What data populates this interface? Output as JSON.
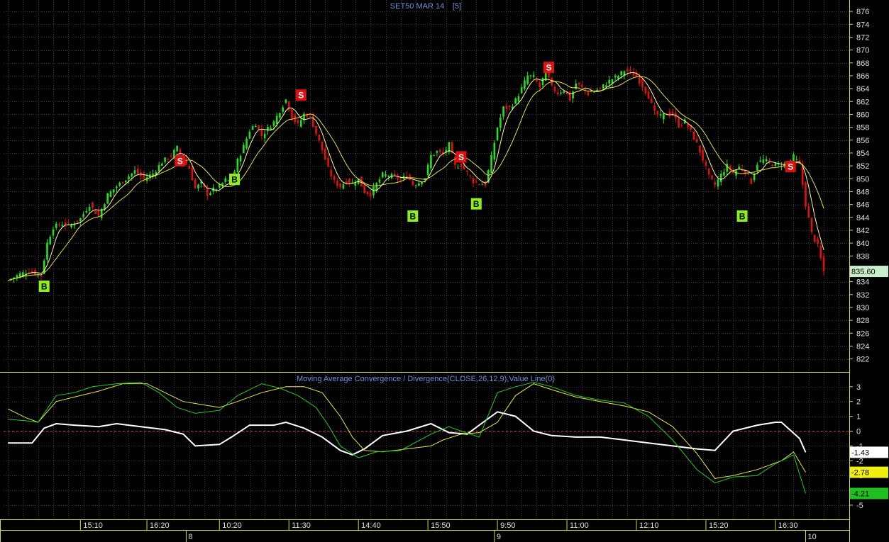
{
  "chart_data": [
    {
      "type": "candlestick",
      "title": "SET50 MAR 14",
      "period": "[5]",
      "ylim": [
        820,
        877
      ],
      "y_ticks": [
        876,
        874,
        872,
        870,
        868,
        866,
        864,
        862,
        860,
        858,
        856,
        854,
        852,
        850,
        848,
        846,
        844,
        842,
        840,
        838,
        836,
        834,
        832,
        830,
        828,
        826,
        824,
        822
      ],
      "last_price": "835.60",
      "colors": {
        "up": "#20e020",
        "down": "#e01010",
        "ma_fast": "#fff8a0",
        "ma_slow": "#e0e040",
        "grid": "#3a3a3a",
        "axis": "#d8d840",
        "title": "#6f8fd8"
      },
      "close_path": [
        [
          0,
          834.2
        ],
        [
          4,
          835.2
        ],
        [
          7,
          835.6
        ],
        [
          11,
          835.0
        ],
        [
          13,
          840.0
        ],
        [
          15,
          842.5
        ],
        [
          18,
          843.0
        ],
        [
          21,
          842.8
        ],
        [
          24,
          843.8
        ],
        [
          27,
          846.0
        ],
        [
          30,
          844.2
        ],
        [
          33,
          847.5
        ],
        [
          36,
          848.8
        ],
        [
          39,
          850.0
        ],
        [
          42,
          851.2
        ],
        [
          45,
          850.0
        ],
        [
          48,
          850.8
        ],
        [
          51,
          852.6
        ],
        [
          54,
          853.6
        ],
        [
          56,
          854.8
        ],
        [
          58,
          852.8
        ],
        [
          60,
          851.6
        ],
        [
          62,
          848.5
        ],
        [
          64,
          849.3
        ],
        [
          66,
          847.6
        ],
        [
          68,
          848.3
        ],
        [
          70,
          848.8
        ],
        [
          72,
          849.8
        ],
        [
          74,
          849.5
        ],
        [
          76,
          852.8
        ],
        [
          78,
          855.0
        ],
        [
          80,
          857.5
        ],
        [
          82,
          858.6
        ],
        [
          84,
          856.7
        ],
        [
          86,
          857.8
        ],
        [
          88,
          858.8
        ],
        [
          90,
          860.6
        ],
        [
          92,
          862.3
        ],
        [
          94,
          859.6
        ],
        [
          96,
          858.3
        ],
        [
          98,
          860.0
        ],
        [
          100,
          859.8
        ],
        [
          102,
          857.0
        ],
        [
          104,
          854.5
        ],
        [
          106,
          851.5
        ],
        [
          108,
          849.5
        ],
        [
          110,
          848.8
        ],
        [
          112,
          849.6
        ],
        [
          114,
          849.3
        ],
        [
          116,
          849.9
        ],
        [
          118,
          848.0
        ],
        [
          120,
          847.6
        ],
        [
          122,
          849.2
        ],
        [
          124,
          850.6
        ],
        [
          126,
          850.5
        ],
        [
          128,
          850.3
        ],
        [
          130,
          849.8
        ],
        [
          132,
          850.6
        ],
        [
          134,
          849.1
        ],
        [
          136,
          849.4
        ],
        [
          138,
          850.2
        ],
        [
          140,
          853.6
        ],
        [
          142,
          854.2
        ],
        [
          144,
          853.8
        ],
        [
          146,
          855.3
        ],
        [
          148,
          851.9
        ],
        [
          150,
          852.1
        ],
        [
          152,
          850.9
        ],
        [
          154,
          849.6
        ],
        [
          156,
          849.3
        ],
        [
          158,
          849.1
        ],
        [
          160,
          853.3
        ],
        [
          162,
          858.0
        ],
        [
          164,
          861.0
        ],
        [
          166,
          861.0
        ],
        [
          168,
          862.2
        ],
        [
          170,
          864.0
        ],
        [
          172,
          866.0
        ],
        [
          174,
          865.8
        ],
        [
          176,
          864.2
        ],
        [
          178,
          866.8
        ],
        [
          180,
          864.2
        ],
        [
          182,
          863.3
        ],
        [
          184,
          863.8
        ],
        [
          186,
          862.3
        ],
        [
          188,
          864.8
        ],
        [
          190,
          864.1
        ],
        [
          192,
          863.2
        ],
        [
          194,
          863.6
        ],
        [
          196,
          864.0
        ],
        [
          198,
          864.8
        ],
        [
          200,
          865.5
        ],
        [
          202,
          866.0
        ],
        [
          204,
          866.8
        ],
        [
          206,
          866.5
        ],
        [
          208,
          865.8
        ],
        [
          210,
          864.5
        ],
        [
          212,
          862.8
        ],
        [
          214,
          860.2
        ],
        [
          216,
          859.6
        ],
        [
          218,
          860.2
        ],
        [
          220,
          860.0
        ],
        [
          222,
          858.3
        ],
        [
          224,
          858.9
        ],
        [
          226,
          857.3
        ],
        [
          228,
          855.4
        ],
        [
          230,
          853.0
        ],
        [
          232,
          850.3
        ],
        [
          234,
          849.0
        ],
        [
          236,
          850.6
        ],
        [
          238,
          852.0
        ],
        [
          240,
          850.9
        ],
        [
          242,
          851.8
        ],
        [
          244,
          851.1
        ],
        [
          246,
          849.5
        ],
        [
          248,
          852.4
        ],
        [
          250,
          852.9
        ],
        [
          252,
          852.5
        ],
        [
          254,
          852.1
        ],
        [
          256,
          852.3
        ],
        [
          258,
          852.0
        ],
        [
          260,
          853.4
        ],
        [
          262,
          852.2
        ],
        [
          264,
          846.0
        ],
        [
          266,
          841.5
        ],
        [
          268,
          839.5
        ],
        [
          270,
          835.6
        ]
      ],
      "signals": [
        {
          "label": "B",
          "x": 12,
          "y": 833.3
        },
        {
          "label": "S",
          "x": 57,
          "y": 852.8
        },
        {
          "label": "B",
          "x": 75,
          "y": 849.9
        },
        {
          "label": "S",
          "x": 97,
          "y": 863.0
        },
        {
          "label": "B",
          "x": 134,
          "y": 844.2
        },
        {
          "label": "S",
          "x": 150,
          "y": 853.4
        },
        {
          "label": "B",
          "x": 155,
          "y": 846.1
        },
        {
          "label": "S",
          "x": 179,
          "y": 867.3
        },
        {
          "label": "B",
          "x": 243,
          "y": 844.2
        },
        {
          "label": "S",
          "x": 259,
          "y": 851.9
        }
      ]
    },
    {
      "type": "line",
      "title": "Moving Average Convergence / Divergence(CLOSE,26,12,9),Value Line(0)",
      "ylim": [
        -6.2,
        3.8
      ],
      "y_ticks": [
        3,
        2,
        1,
        0,
        -1,
        -2,
        -3,
        -4,
        -5
      ],
      "last_values": [
        "-1.43",
        "-2.78",
        "-4.21"
      ],
      "series": [
        {
          "values": [
            [
              0,
              -0.8
            ],
            [
              8,
              -0.8
            ],
            [
              12,
              0.2
            ],
            [
              16,
              0.5
            ],
            [
              22,
              0.4
            ],
            [
              30,
              0.3
            ],
            [
              36,
              0.5
            ],
            [
              44,
              0.3
            ],
            [
              52,
              0.1
            ],
            [
              58,
              -0.2
            ],
            [
              62,
              -1.0
            ],
            [
              70,
              -0.9
            ],
            [
              74,
              -0.4
            ],
            [
              80,
              0.4
            ],
            [
              88,
              0.4
            ],
            [
              92,
              0.6
            ],
            [
              98,
              0.2
            ],
            [
              104,
              -0.4
            ],
            [
              110,
              -1.3
            ],
            [
              114,
              -1.6
            ],
            [
              118,
              -1.2
            ],
            [
              124,
              -0.3
            ],
            [
              132,
              0.0
            ],
            [
              140,
              0.5
            ],
            [
              146,
              -0.1
            ],
            [
              152,
              -0.2
            ],
            [
              156,
              0.4
            ],
            [
              162,
              1.3
            ],
            [
              168,
              1.0
            ],
            [
              174,
              0.0
            ],
            [
              180,
              -0.3
            ],
            [
              188,
              -0.4
            ],
            [
              196,
              -0.4
            ],
            [
              204,
              -0.6
            ],
            [
              212,
              -0.8
            ],
            [
              220,
              -1.0
            ],
            [
              228,
              -1.2
            ],
            [
              234,
              -1.3
            ],
            [
              240,
              0.0
            ],
            [
              248,
              0.4
            ],
            [
              254,
              0.6
            ],
            [
              256,
              0.6
            ],
            [
              262,
              -0.5
            ],
            [
              264,
              -1.43
            ]
          ]
        },
        {
          "values": [
            [
              0,
              1.5
            ],
            [
              6,
              0.9
            ],
            [
              10,
              0.6
            ],
            [
              16,
              2.0
            ],
            [
              22,
              2.3
            ],
            [
              30,
              2.7
            ],
            [
              38,
              3.2
            ],
            [
              46,
              3.2
            ],
            [
              52,
              2.6
            ],
            [
              58,
              2.0
            ],
            [
              64,
              1.8
            ],
            [
              70,
              1.6
            ],
            [
              76,
              2.0
            ],
            [
              84,
              2.6
            ],
            [
              92,
              3.0
            ],
            [
              98,
              3.0
            ],
            [
              104,
              2.6
            ],
            [
              110,
              1.0
            ],
            [
              114,
              -0.4
            ],
            [
              118,
              -1.3
            ],
            [
              124,
              -1.4
            ],
            [
              132,
              -1.2
            ],
            [
              140,
              -1.0
            ],
            [
              144,
              -0.6
            ],
            [
              150,
              -0.2
            ],
            [
              156,
              -0.1
            ],
            [
              162,
              0.6
            ],
            [
              168,
              2.4
            ],
            [
              174,
              3.2
            ],
            [
              180,
              2.8
            ],
            [
              188,
              2.3
            ],
            [
              196,
              2.0
            ],
            [
              204,
              1.7
            ],
            [
              212,
              1.3
            ],
            [
              220,
              0.3
            ],
            [
              228,
              -1.5
            ],
            [
              234,
              -3.2
            ],
            [
              240,
              -3.0
            ],
            [
              248,
              -2.6
            ],
            [
              256,
              -2.0
            ],
            [
              260,
              -1.4
            ],
            [
              264,
              -2.78
            ]
          ]
        },
        {
          "values": [
            [
              0,
              0.8
            ],
            [
              6,
              0.7
            ],
            [
              10,
              0.6
            ],
            [
              16,
              2.4
            ],
            [
              22,
              2.6
            ],
            [
              28,
              3.0
            ],
            [
              36,
              3.2
            ],
            [
              44,
              3.3
            ],
            [
              50,
              2.6
            ],
            [
              56,
              1.6
            ],
            [
              62,
              1.2
            ],
            [
              70,
              1.4
            ],
            [
              76,
              2.4
            ],
            [
              84,
              3.2
            ],
            [
              90,
              2.9
            ],
            [
              96,
              2.4
            ],
            [
              102,
              1.6
            ],
            [
              106,
              0.4
            ],
            [
              110,
              -1.0
            ],
            [
              116,
              -1.8
            ],
            [
              122,
              -1.4
            ],
            [
              130,
              -1.3
            ],
            [
              140,
              -0.2
            ],
            [
              146,
              0.3
            ],
            [
              150,
              0.0
            ],
            [
              156,
              -0.4
            ],
            [
              162,
              2.6
            ],
            [
              168,
              3.0
            ],
            [
              174,
              3.3
            ],
            [
              180,
              3.0
            ],
            [
              188,
              2.4
            ],
            [
              196,
              2.1
            ],
            [
              204,
              1.9
            ],
            [
              212,
              1.0
            ],
            [
              220,
              -0.6
            ],
            [
              228,
              -2.6
            ],
            [
              234,
              -3.5
            ],
            [
              240,
              -3.1
            ],
            [
              248,
              -3.0
            ],
            [
              254,
              -2.2
            ],
            [
              260,
              -1.6
            ],
            [
              264,
              -4.21
            ]
          ]
        }
      ]
    }
  ],
  "x_axis": {
    "time_labels": [
      {
        "label": "15:10",
        "x": 24
      },
      {
        "label": "16:20",
        "x": 46
      },
      {
        "label": "10:20",
        "x": 70
      },
      {
        "label": "11:30",
        "x": 93
      },
      {
        "label": "14:40",
        "x": 116
      },
      {
        "label": "15:50",
        "x": 139
      },
      {
        "label": "9:50",
        "x": 162
      },
      {
        "label": "11:00",
        "x": 185
      },
      {
        "label": "12:10",
        "x": 208
      },
      {
        "label": "15:20",
        "x": 231
      },
      {
        "label": "16:30",
        "x": 254
      }
    ],
    "day_labels": [
      {
        "label": "8",
        "x": 59
      },
      {
        "label": "9",
        "x": 161
      },
      {
        "label": "10",
        "x": 264
      }
    ]
  }
}
